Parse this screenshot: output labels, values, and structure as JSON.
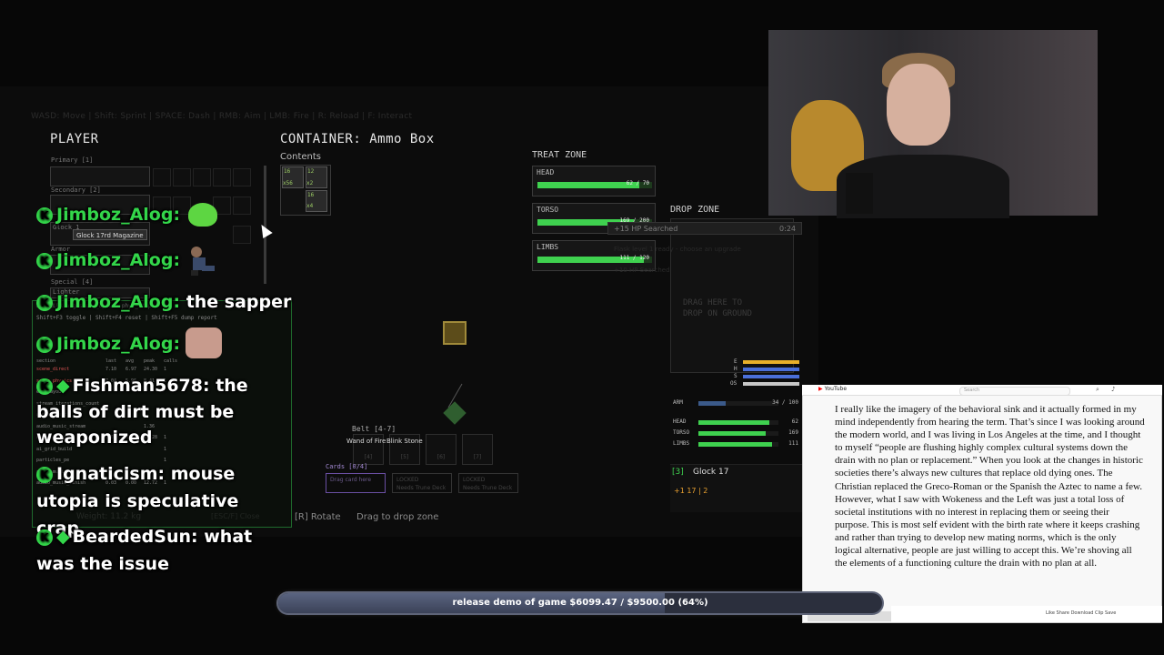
{
  "game": {
    "hint_bar": "WASD: Move | Shift: Sprint | SPACE: Dash | RMB: Aim | LMB: Fire | R: Reload | F: Interact",
    "player_title": "PLAYER",
    "primary_label": "Primary [1]",
    "secondary_label": "Secondary [2]",
    "sidearm_label": "Glock 1",
    "armor_label": "Armor",
    "special_label": "Special [4]",
    "lighter_label": "Lighter",
    "tooltip": "Glock 17rd Magazine",
    "container_title": "CONTAINER: Ammo Box",
    "contents_label": "Contents",
    "ammo_cells": [
      "16",
      "12",
      "x56",
      "x2",
      "16",
      "x4"
    ],
    "treat_zone_title": "TREAT ZONE",
    "zones": [
      {
        "label": "HEAD",
        "value": "62 / 70",
        "fill": 0.886
      },
      {
        "label": "TORSO",
        "value": "169 / 200",
        "fill": 0.845
      },
      {
        "label": "LIMBS",
        "value": "111 / 120",
        "fill": 0.925
      }
    ],
    "drop_zone_title": "DROP ZONE",
    "searched_popup": "+15 HP Searched",
    "searched_timer": "0:24",
    "ghost_1": "Flask level 1 ready - choose an upgrade",
    "ghost_2": "+10 HP Searched",
    "drop_hint_1": "DRAG HERE TO",
    "drop_hint_2": "DROP ON GROUND",
    "stats": [
      {
        "label": "ARM",
        "value": "34 / 100",
        "fill": 0.34,
        "color": "#3b5a8a"
      },
      {
        "label": "HEAD",
        "value": "62",
        "fill": 0.886,
        "color": "#3fd14f"
      },
      {
        "label": "TORSO",
        "value": "169",
        "fill": 0.845,
        "color": "#3fd14f"
      },
      {
        "label": "LIMBS",
        "value": "111",
        "fill": 0.925,
        "color": "#3fd14f"
      }
    ],
    "energy_labels": [
      "E",
      "H",
      "S",
      "OS"
    ],
    "weapon_slot": "[3]",
    "weapon_name": "Glock 17",
    "weapon_ammo": "+1 17 | 2",
    "belt_label": "Belt [4-7]",
    "belt_item_1": "Wand of Fire",
    "belt_item_2": "Blink Stone",
    "belt_keys": [
      "[4]",
      "[5]",
      "[6]",
      "[7]"
    ],
    "cards_label": "Cards [0/4]",
    "card_drag": "Drag card here",
    "card_locked": "LOCKED",
    "card_locked_sub": "Needs Trune Deck",
    "rotate_hint": "[R] Rotate",
    "drag_hint": "Drag to drop zone",
    "weight_label": "Weight: 11.2 kg",
    "close_hint": "[ESC/F] Close",
    "debug_line1": "PROFILER avg scene_update phys_step",
    "debug_line2": "Shift+F3 toggle | Shift+F4 reset | Shift+F5 dump report",
    "debug_headers": [
      "section",
      "last",
      "avg",
      "peak",
      "calls"
    ],
    "debug_rows": [
      [
        "scene_direct",
        "7.10",
        "6.97",
        "24.30",
        "1"
      ],
      [
        "scene_physics",
        "7.04",
        "5.96",
        "8.41",
        "1"
      ],
      [
        "ecs_layout",
        "",
        "",
        "",
        ""
      ],
      [
        "stream_iterations_count",
        "",
        "",
        "",
        ""
      ],
      [
        "audio_music",
        "",
        "",
        "",
        ""
      ],
      [
        "audio_music_stream",
        "",
        "",
        "1.36",
        ""
      ],
      [
        "ai_grid_build",
        "0.03",
        "0.02",
        "26.28",
        "1"
      ],
      [
        "ai_grid_build",
        "",
        "",
        "",
        "1"
      ],
      [
        "particles_pe",
        "",
        "",
        "",
        "1"
      ],
      [
        "audio_music",
        "",
        "",
        "",
        ""
      ],
      [
        "audio_music_finish",
        "0.03",
        "0.00",
        "12.72",
        "1"
      ]
    ]
  },
  "chat": [
    {
      "user": "Jimboz_Alog:",
      "message": "",
      "badges": [
        "K"
      ]
    },
    {
      "user": "Jimboz_Alog:",
      "message": "",
      "badges": [
        "K"
      ]
    },
    {
      "user": "Jimboz_Alog:",
      "message": "the sapper",
      "badges": [
        "K"
      ]
    },
    {
      "user": "Jimboz_Alog:",
      "message": "",
      "badges": [
        "K"
      ]
    },
    {
      "user": "Fishman5678:",
      "message_lines": [
        "the",
        "balls of dirt must be",
        "weaponized"
      ],
      "badges": [
        "K",
        "diamond"
      ]
    },
    {
      "user": "Ignaticism:",
      "message_lines": [
        "mouse",
        "utopia is speculative crap"
      ],
      "badges": [
        "K"
      ]
    },
    {
      "user": "BeardedSun:",
      "message_lines": [
        "what",
        "was the issue"
      ],
      "badges": [
        "K",
        "diamond"
      ]
    }
  ],
  "youtube": {
    "logo": "YouTube",
    "search_placeholder": "Search",
    "actions": "Like  Share  Download  Clip  Save",
    "text": "I really like the imagery of the behavioral sink and it actually formed in my mind independently from hearing the term. That’s since I was looking around the modern world, and I was living in Los Angeles at the time, and I thought to myself “people are flushing highly complex cultural systems down the drain with no plan or replacement.” When you look at the changes in historic societies there’s always new cultures that replace old dying ones. The Christian replaced the Greco-Roman or the Spanish the Aztec to name a few. However, what I saw with Wokeness and the Left was just a total loss of societal institutions with no interest in replacing them or seeing their purpose. This is most self evident with the birth rate where it keeps crashing and rather than trying to develop new mating norms, which is the only logical alternative, people are just willing to accept this. We’re shoving all the elements of a functioning culture the drain with no plan at all."
  },
  "goal": {
    "text": "release demo of game $6099.47 / $9500.00 (64%)",
    "progress": 0.64
  }
}
